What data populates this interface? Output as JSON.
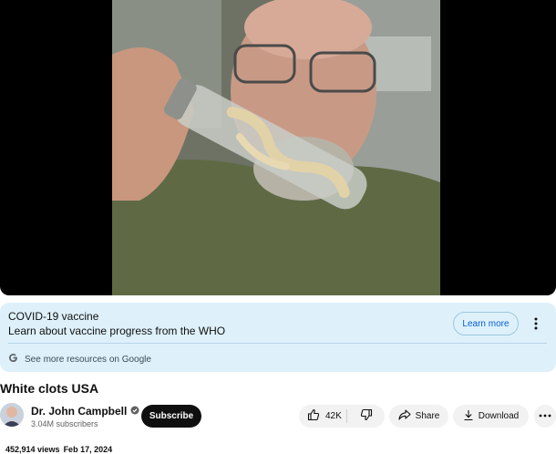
{
  "video": {
    "title": "White clots USA",
    "frame_description_icon": "video-frame"
  },
  "info_panel": {
    "title": "COVID-19 vaccine",
    "subtitle": "Learn about vaccine progress from the WHO",
    "learn_more": "Learn more",
    "google_link": "See more resources on Google"
  },
  "channel": {
    "name": "Dr. John Campbell",
    "subscribers": "3.04M subscribers",
    "subscribe_label": "Subscribe",
    "verified_icon": "verified-check-icon"
  },
  "actions": {
    "likes": "42K",
    "share_label": "Share",
    "download_label": "Download"
  },
  "meta": {
    "views": "452,914 views",
    "date": "Feb 17, 2024"
  },
  "colors": {
    "info_bg": "#def1fb",
    "accent_blue": "#065fd4",
    "pill_bg": "#f2f2f2"
  }
}
